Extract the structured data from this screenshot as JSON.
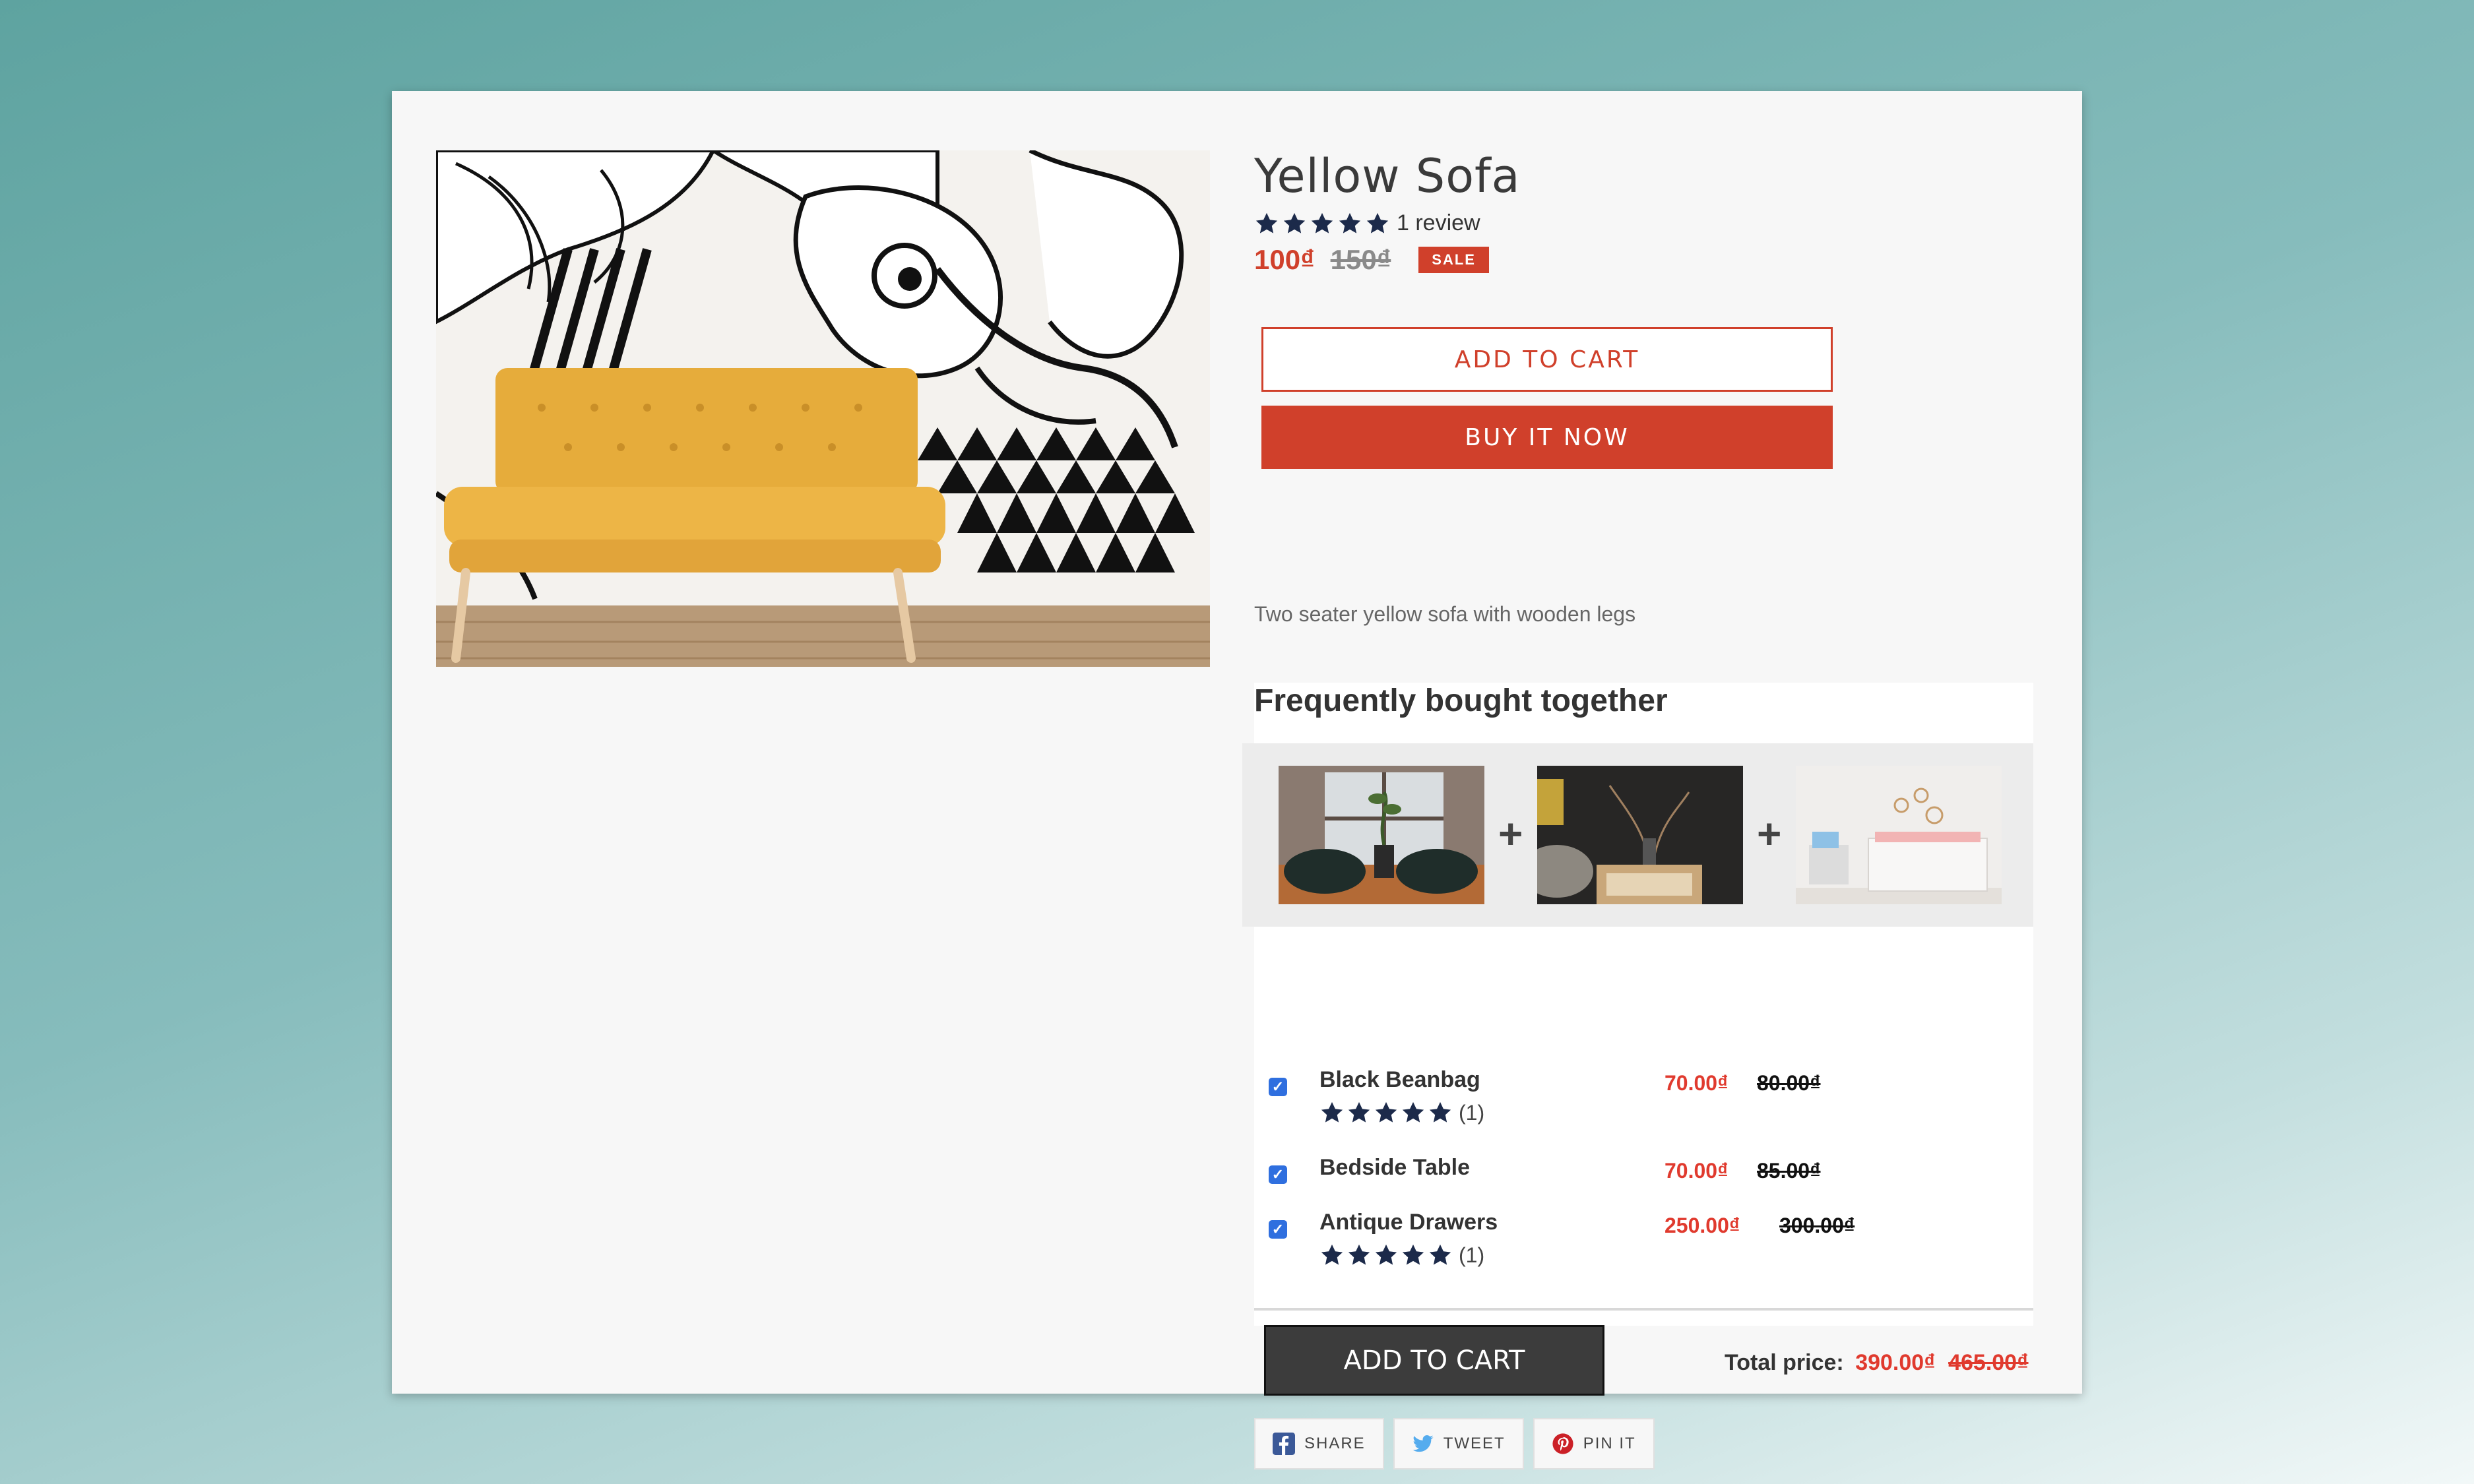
{
  "product": {
    "title": "Yellow Sofa",
    "rating": 5,
    "review_text": "1 review",
    "price": "100₫",
    "compare_price": "150₫",
    "sale_badge": "SALE",
    "add_to_cart": "ADD TO CART",
    "buy_now": "BUY IT NOW",
    "description": "Two seater yellow sofa with wooden legs"
  },
  "bundle": {
    "title": "Frequently bought together",
    "plus": "+",
    "items": [
      {
        "name": "Black Beanbag",
        "rating": 5,
        "count": "(1)",
        "price": "70.00₫",
        "compare": "80.00₫",
        "checked": true
      },
      {
        "name": "Bedside Table",
        "price": "70.00₫",
        "compare": "85.00₫",
        "checked": true
      },
      {
        "name": "Antique Drawers",
        "rating": 5,
        "count": "(1)",
        "price": "250.00₫",
        "compare": "300.00₫",
        "checked": true
      }
    ],
    "add_to_cart": "ADD TO CART",
    "total_label": "Total price:",
    "total": "390.00₫",
    "total_compare": "465.00₫"
  },
  "share": {
    "facebook": "SHARE",
    "twitter": "TWEET",
    "pinterest": "PIN IT"
  },
  "colors": {
    "accent": "#d0402b",
    "star": "#1c2a4a",
    "bundle_price": "#e03a2e"
  }
}
